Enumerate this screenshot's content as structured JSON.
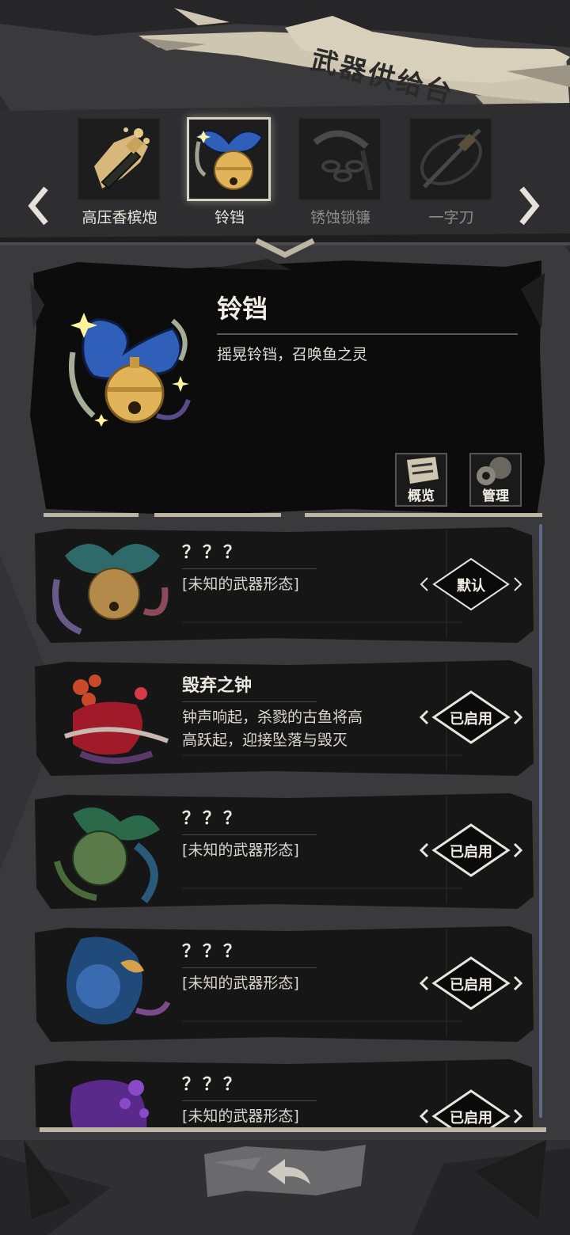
{
  "header": {
    "title": "武器供给台"
  },
  "carousel": {
    "prev_icon": "chevron-left-icon",
    "next_icon": "chevron-right-icon",
    "items": [
      {
        "label": "高压香槟炮",
        "icon": "champagne-icon",
        "state": "normal"
      },
      {
        "label": "铃铛",
        "icon": "bell-icon",
        "state": "selected"
      },
      {
        "label": "锈蚀锁镰",
        "icon": "chain-sickle-icon",
        "state": "locked"
      },
      {
        "label": "一字刀",
        "icon": "katana-icon",
        "state": "locked"
      }
    ]
  },
  "detail": {
    "name": "铃铛",
    "description": "摇晃铃铛，召唤鱼之灵",
    "overview_label": "概览",
    "manage_label": "管理"
  },
  "forms": [
    {
      "title": "？？？",
      "desc": "[未知的武器形态]",
      "button": "默认",
      "theme": "teal"
    },
    {
      "title": "毁弃之钟",
      "desc": "钟声响起，杀戮的古鱼将高高跃起，迎接坠落与毁灭",
      "desc_lines": [
        "钟声响起，杀戮的古鱼将高",
        "高跃起，迎接坠落与毁灭"
      ],
      "button": "已启用",
      "theme": "red"
    },
    {
      "title": "？？？",
      "desc": "[未知的武器形态]",
      "button": "已启用",
      "theme": "green"
    },
    {
      "title": "？？？",
      "desc": "[未知的武器形态]",
      "button": "已启用",
      "theme": "blue"
    },
    {
      "title": "？？？",
      "desc": "[未知的武器形态]",
      "button": "已启用",
      "theme": "purple"
    }
  ],
  "footer": {
    "back_icon": "back-arrow-icon"
  },
  "colors": {
    "background": "#3a3a3c",
    "panel": "#0d0d0d",
    "accent_gold": "#e2b45a",
    "bow_blue": "#2f5fb8",
    "text_light": "#ece8e0",
    "paper": "#cfc6b2"
  }
}
